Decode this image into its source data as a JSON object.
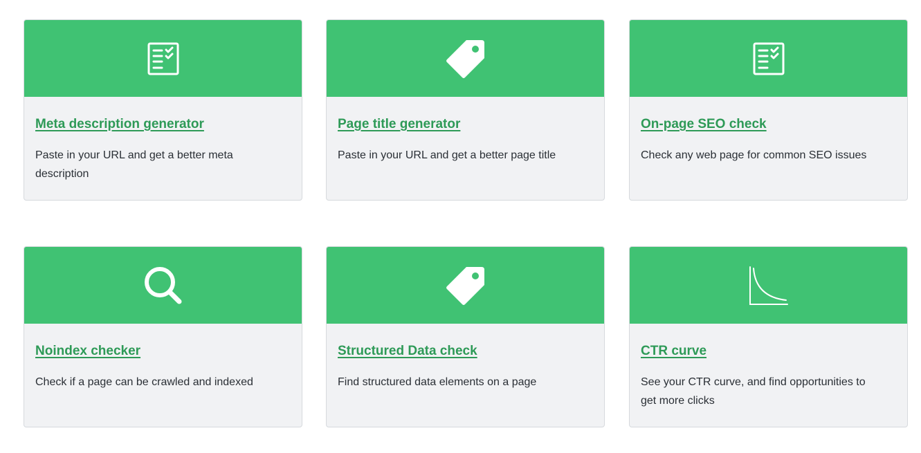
{
  "header_color": "#40c273",
  "link_color": "#2e9a57",
  "cards": [
    {
      "icon": "checklist-icon",
      "title": "Meta description generator",
      "description": "Paste in your URL and get a better meta description"
    },
    {
      "icon": "tag-icon",
      "title": "Page title generator",
      "description": "Paste in your URL and get a better page title"
    },
    {
      "icon": "checklist-icon",
      "title": "On-page SEO check",
      "description": "Check any web page for common SEO issues"
    },
    {
      "icon": "search-icon",
      "title": "Noindex checker",
      "description": "Check if a page can be crawled and indexed"
    },
    {
      "icon": "tag-icon",
      "title": "Structured Data check",
      "description": "Find structured data elements on a page"
    },
    {
      "icon": "curve-chart-icon",
      "title": "CTR curve",
      "description": "See your CTR curve, and find opportunities to get more clicks"
    }
  ]
}
